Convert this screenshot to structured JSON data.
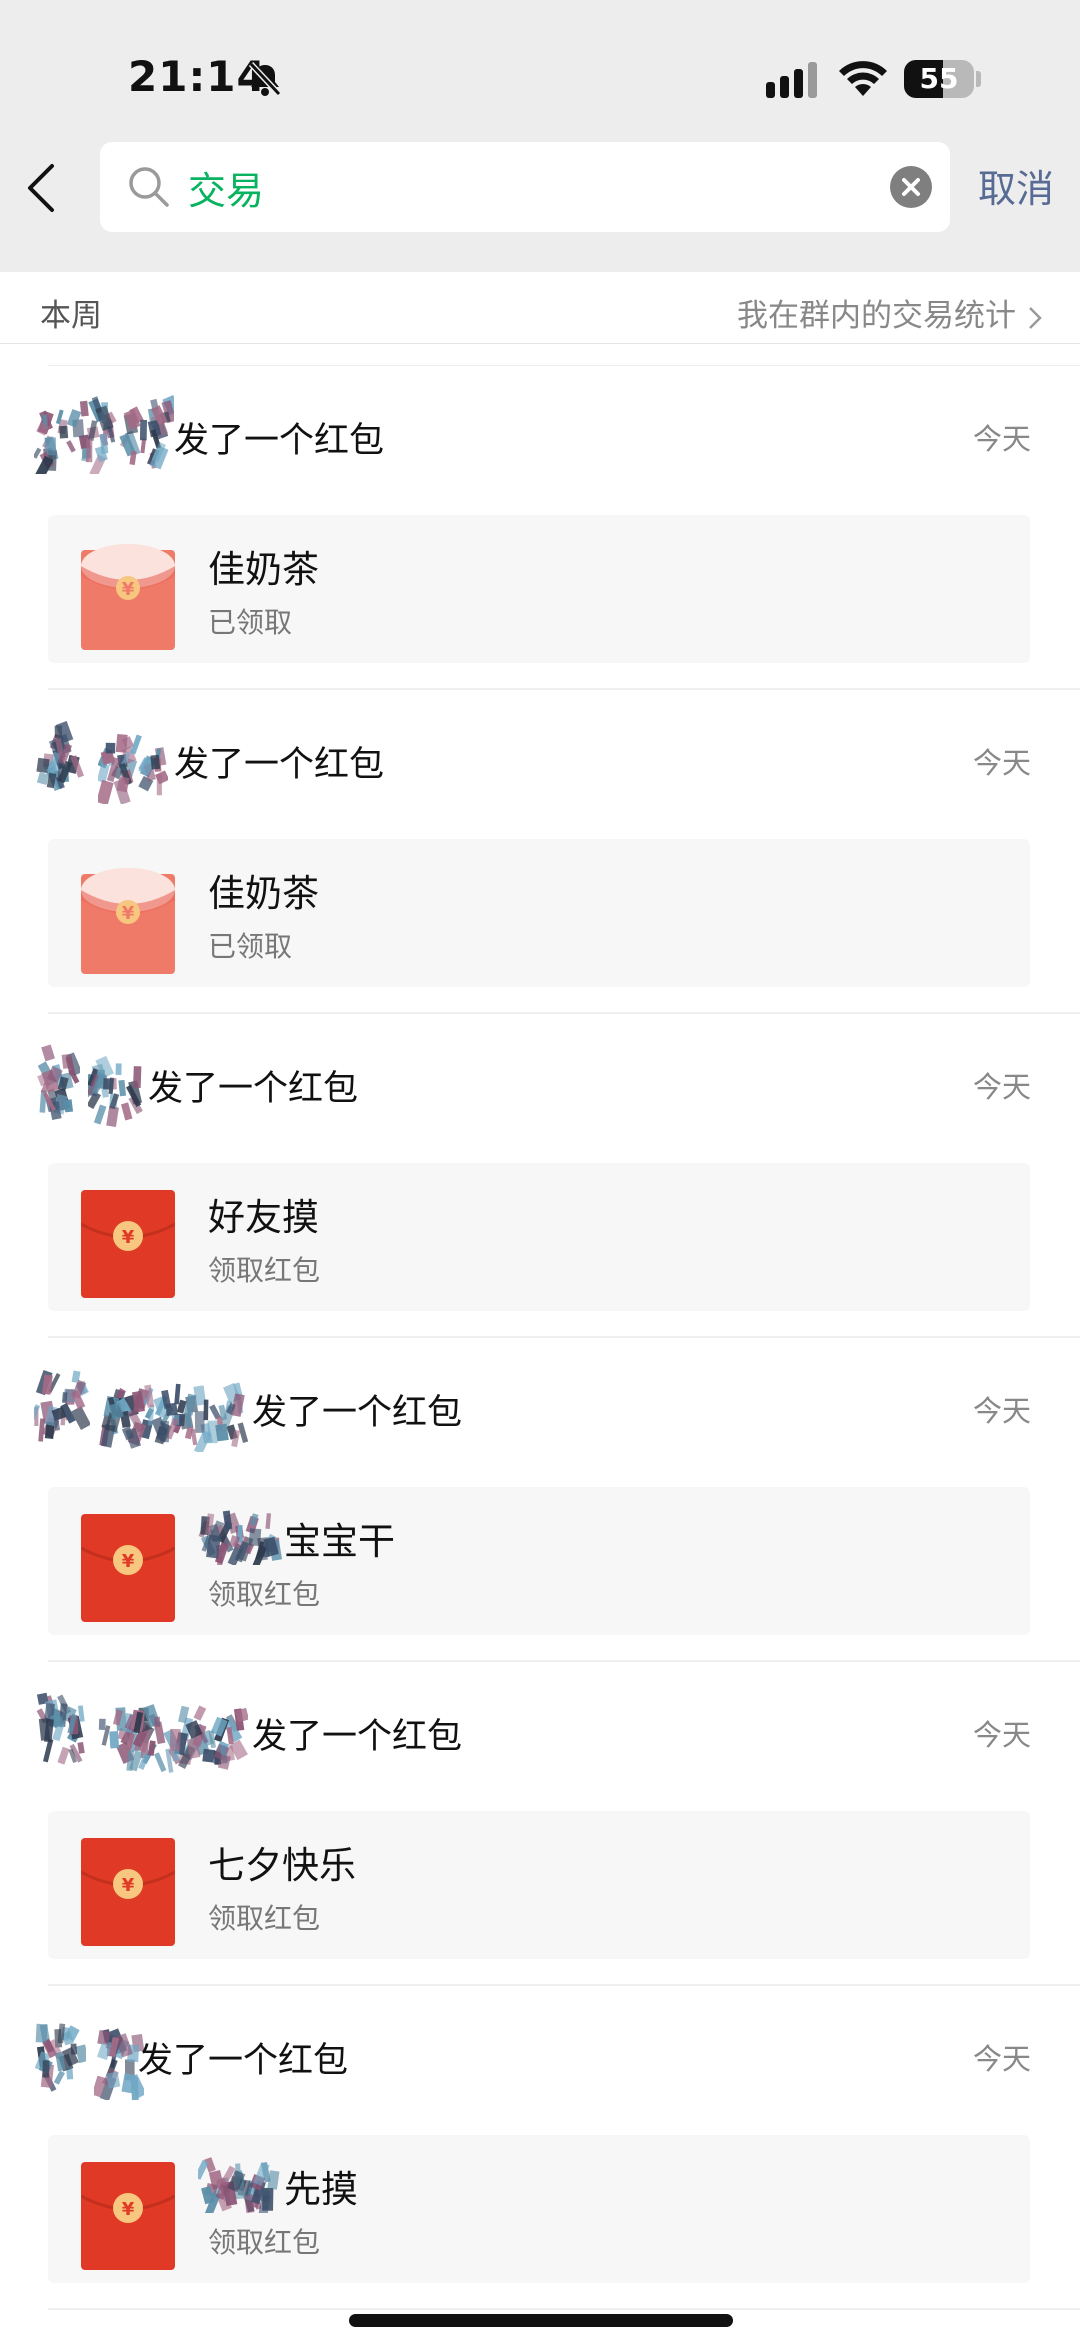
{
  "status_bar": {
    "time": "21:14",
    "battery": "55",
    "battery_level": 0.55
  },
  "search": {
    "query": "交易",
    "cancel_label": "取消"
  },
  "section": {
    "week_label": "本周",
    "stats_link": "我在群内的交易统计"
  },
  "items": [
    {
      "action": "发了一个红包",
      "time": "今天",
      "title": "佳奶茶",
      "status": "已领取",
      "opened": true
    },
    {
      "action": "发了一个红包",
      "time": "今天",
      "title": "佳奶茶",
      "status": "已领取",
      "opened": true
    },
    {
      "action": "发了一个红包",
      "time": "今天",
      "title": "好友摸",
      "status": "领取红包",
      "opened": false
    },
    {
      "action": "发了一个红包",
      "time": "今天",
      "title": "宝宝干",
      "status": "领取红包",
      "opened": false
    },
    {
      "action": "发了一个红包",
      "time": "今天",
      "title": "七夕快乐",
      "status": "领取红包",
      "opened": false
    },
    {
      "action": "发了一个红包",
      "time": "今天",
      "title": "先摸",
      "status": "领取红包",
      "opened": false
    }
  ],
  "icons": {
    "coin_symbol": "¥",
    "envelope_unopened": "#e03a27",
    "envelope_opened": "#f07a68",
    "seal": "#f7c780",
    "accent_green": "#07b35f",
    "link_blue": "#576b95"
  }
}
